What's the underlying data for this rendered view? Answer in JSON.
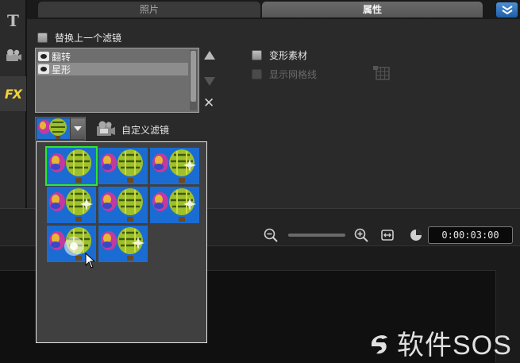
{
  "tabs": {
    "photo": "照片",
    "attributes": "属性"
  },
  "panel": {
    "replace_previous_filter": "替换上一个滤镜",
    "filter_list": [
      "翻转",
      "星形"
    ],
    "selected_filter_index": 1,
    "morph_clip": "变形素材",
    "show_grid_lines": "显示网格线",
    "custom_filter": "自定义滤镜"
  },
  "timeline": {
    "timecode": "0:00:03:00",
    "zoom_level": 0.5
  },
  "popup": {
    "presets": 8,
    "selected_preset": 1
  },
  "icons": {
    "text_tool": "text-icon",
    "media_tool": "film-reel-icon",
    "fx_tool": "fx-icon",
    "move_up": "triangle-up-icon",
    "move_down": "triangle-down-icon",
    "delete": "close-icon",
    "grid": "grid-icon",
    "zoom_out": "zoom-out-icon",
    "zoom_in": "zoom-in-icon",
    "fit": "fit-to-window-icon",
    "clock": "clock-icon"
  },
  "lb_labels": {
    "text": "T",
    "fx": "FX"
  },
  "watermark": "软件SOS",
  "colors": {
    "accent_blue": "#1e5ea8",
    "selection_green": "#2ee82e",
    "fx_yellow": "#f2d23a"
  }
}
